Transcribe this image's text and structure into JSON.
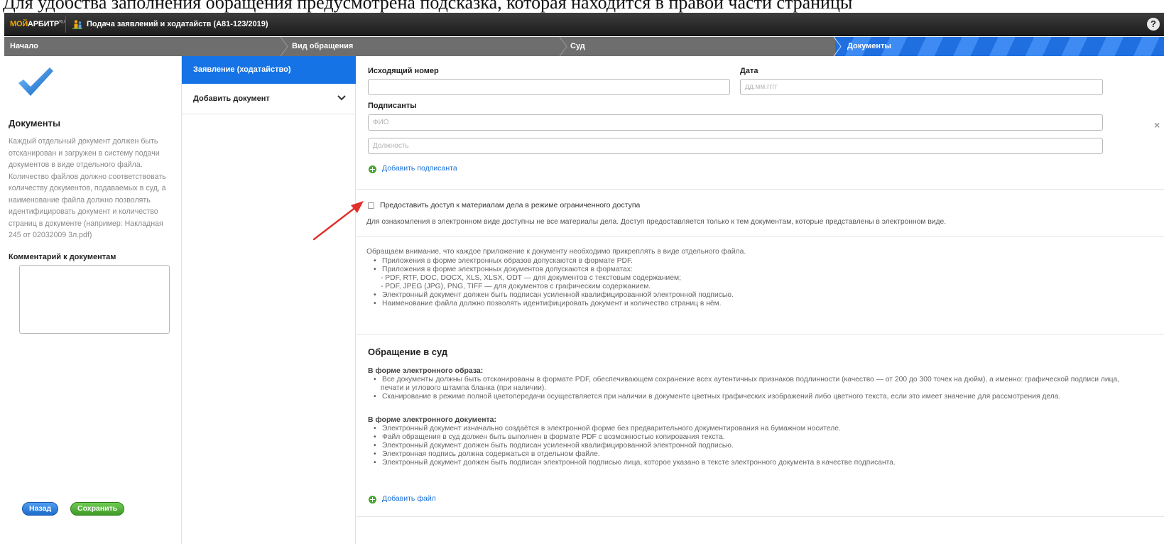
{
  "crop_text": "Для удобства заполнения обращения предусмотрена подсказка, которая находится в правой части страницы",
  "topbar": {
    "logo_prefix": "МОЙ",
    "logo_main": "АРБИТР",
    "logo_suffix": "RU",
    "title": "Подача заявлений и ходатайств (А81-123/2019)",
    "help": "?"
  },
  "steps": [
    "Начало",
    "Вид обращения",
    "Суд",
    "Документы"
  ],
  "left": {
    "title": "Документы",
    "text": "Каждый отдельный документ должен быть отсканирован и загружен в систему подачи документов в виде отдельного файла. Количество файлов должно соответствовать количеству документов, подаваемых в суд, а наименование файла должно позволять идентифицировать документ и количество страниц в документе (например: Накладная 245 от 02032009 3л.pdf)",
    "comment_label": "Комментарий к документам",
    "back_label": "Назад",
    "save_label": "Сохранить"
  },
  "middle": {
    "active_item": "Заявление (ходатайство)",
    "add_item": "Добавить документ"
  },
  "form": {
    "outgoing_label": "Исходящий номер",
    "date_label": "Дата",
    "date_placeholder": "дд.мм.гггг",
    "signers_label": "Подписанты",
    "fio_placeholder": "ФИО",
    "position_placeholder": "Должность",
    "add_signer": "Добавить подписанта",
    "access_checkbox": "Предоставить доступ к материалам дела в режиме ограниченного доступа",
    "access_note": "Для ознакомления в электронном виде доступны не все материалы дела. Доступ предоставляется только к тем документам, которые представлены в электронном виде."
  },
  "info": {
    "intro": "Обращаем внимание, что каждое приложение к документу необходимо прикреплять в виде отдельного файла.",
    "items": [
      {
        "text": "Приложения в форме электронных образов допускаются в формате PDF.",
        "sub": false
      },
      {
        "text": "Приложения в форме электронных документов допускаются в форматах:",
        "sub": false
      },
      {
        "text": "- PDF, RTF, DOC, DOCX, XLS, XLSX, ODT — для документов с текстовым содержанием;",
        "sub": true
      },
      {
        "text": "- PDF, JPEG (JPG), PNG, TIFF — для документов с графическим содержанием.",
        "sub": true
      },
      {
        "text": "Электронный документ должен быть подписан усиленной квалифицированной электронной подписью.",
        "sub": false
      },
      {
        "text": "Наименование файла должно позволять идентифицировать документ и количество страниц в нём.",
        "sub": false
      }
    ]
  },
  "court": {
    "title": "Обращение в суд",
    "image_title": "В форме электронного образа:",
    "image_items": [
      {
        "text": "Все документы должны быть отсканированы в формате PDF, обеспечивающем сохранение всех аутентичных признаков подлинности (качество — от 200 до 300 точек на дюйм), а именно: графической подписи лица,",
        "sub": false
      },
      {
        "text": "печати и углового штампа бланка (при наличии).",
        "sub": true
      },
      {
        "text": "Сканирование в режиме полной цветопередачи осуществляется при наличии в документе цветных графических изображений либо цветного текста, если это имеет значение для рассмотрения дела.",
        "sub": false
      }
    ],
    "doc_title": "В форме электронного документа:",
    "doc_items": [
      {
        "text": "Электронный документ изначально создаётся в электронной форме без предварительного документирования на бумажном носителе.",
        "sub": false
      },
      {
        "text": "Файл обращения в суд должен быть выполнен в формате PDF с возможностью копирования текста.",
        "sub": false
      },
      {
        "text": "Электронный документ должен быть подписан усиленной квалифицированной электронной подписью.",
        "sub": false
      },
      {
        "text": "Электронная подпись должна содержаться в отдельном файле.",
        "sub": false
      },
      {
        "text": "Электронный документ должен быть подписан электронной подписью лица, которое указано в тексте электронного документа в качестве подписанта.",
        "sub": false
      }
    ],
    "add_file": "Добавить файл"
  },
  "colors": {
    "accent": "#1673e6",
    "save": "#46a82d",
    "link": "#1a6fd8",
    "annotation_arrow": "#e0302b"
  }
}
